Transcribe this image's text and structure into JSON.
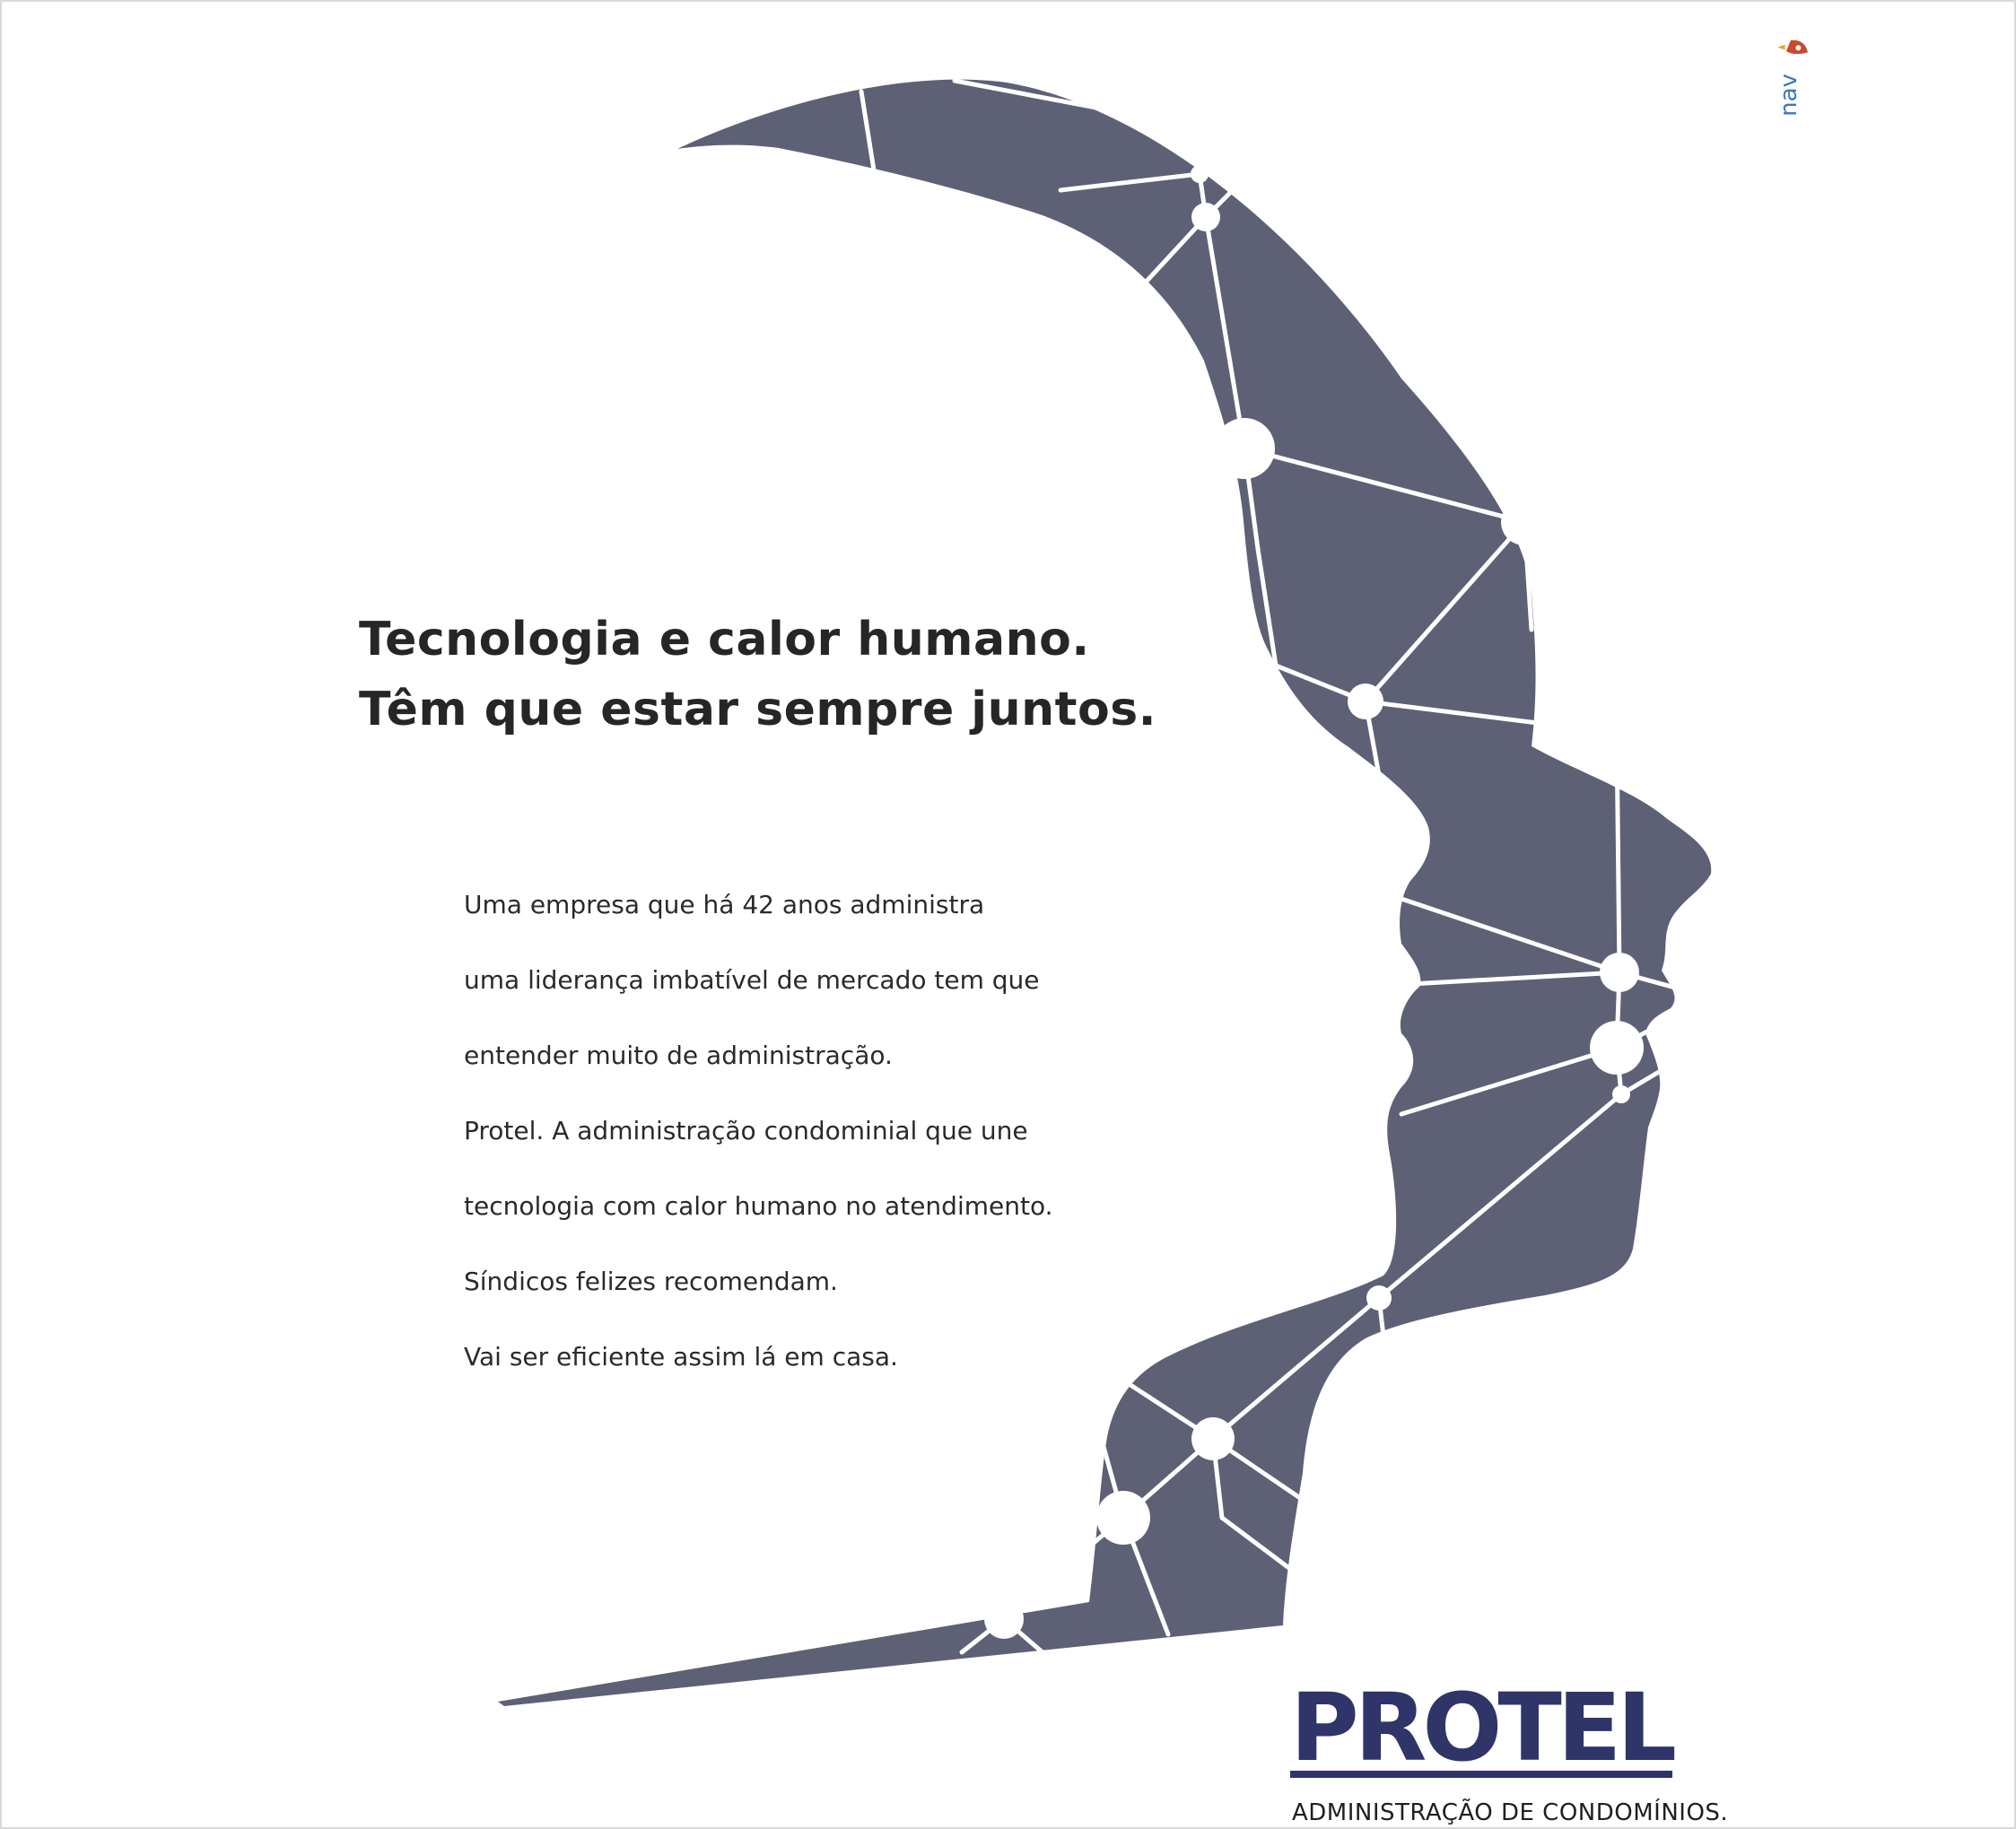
{
  "ad": {
    "headline": [
      "Tecnologia e calor humano.",
      "Têm que estar sempre juntos."
    ],
    "body": [
      "Uma empresa que há 42 anos administra",
      "uma liderança imbatível de mercado tem que",
      "entender muito de administração.",
      "Protel. A administração condominial que une",
      "tecnologia com calor humano no atendimento.",
      "Síndicos felizes recomendam.",
      "Vai ser eficiente assim lá em casa."
    ],
    "brand": {
      "logo_text": "PROTEL",
      "tagline": "ADMINISTRAÇÃO DE CONDOMÍNIOS."
    },
    "agency_mark": "nav"
  },
  "colors": {
    "silhouette": "#5e6076",
    "network_lines": "#ffffff",
    "logo": "#2f3568",
    "text": "#262626",
    "background": "#ffffff"
  },
  "icons": {
    "face_silhouette": "human-profile-network-illustration",
    "agency_mark": "rocket-icon"
  }
}
